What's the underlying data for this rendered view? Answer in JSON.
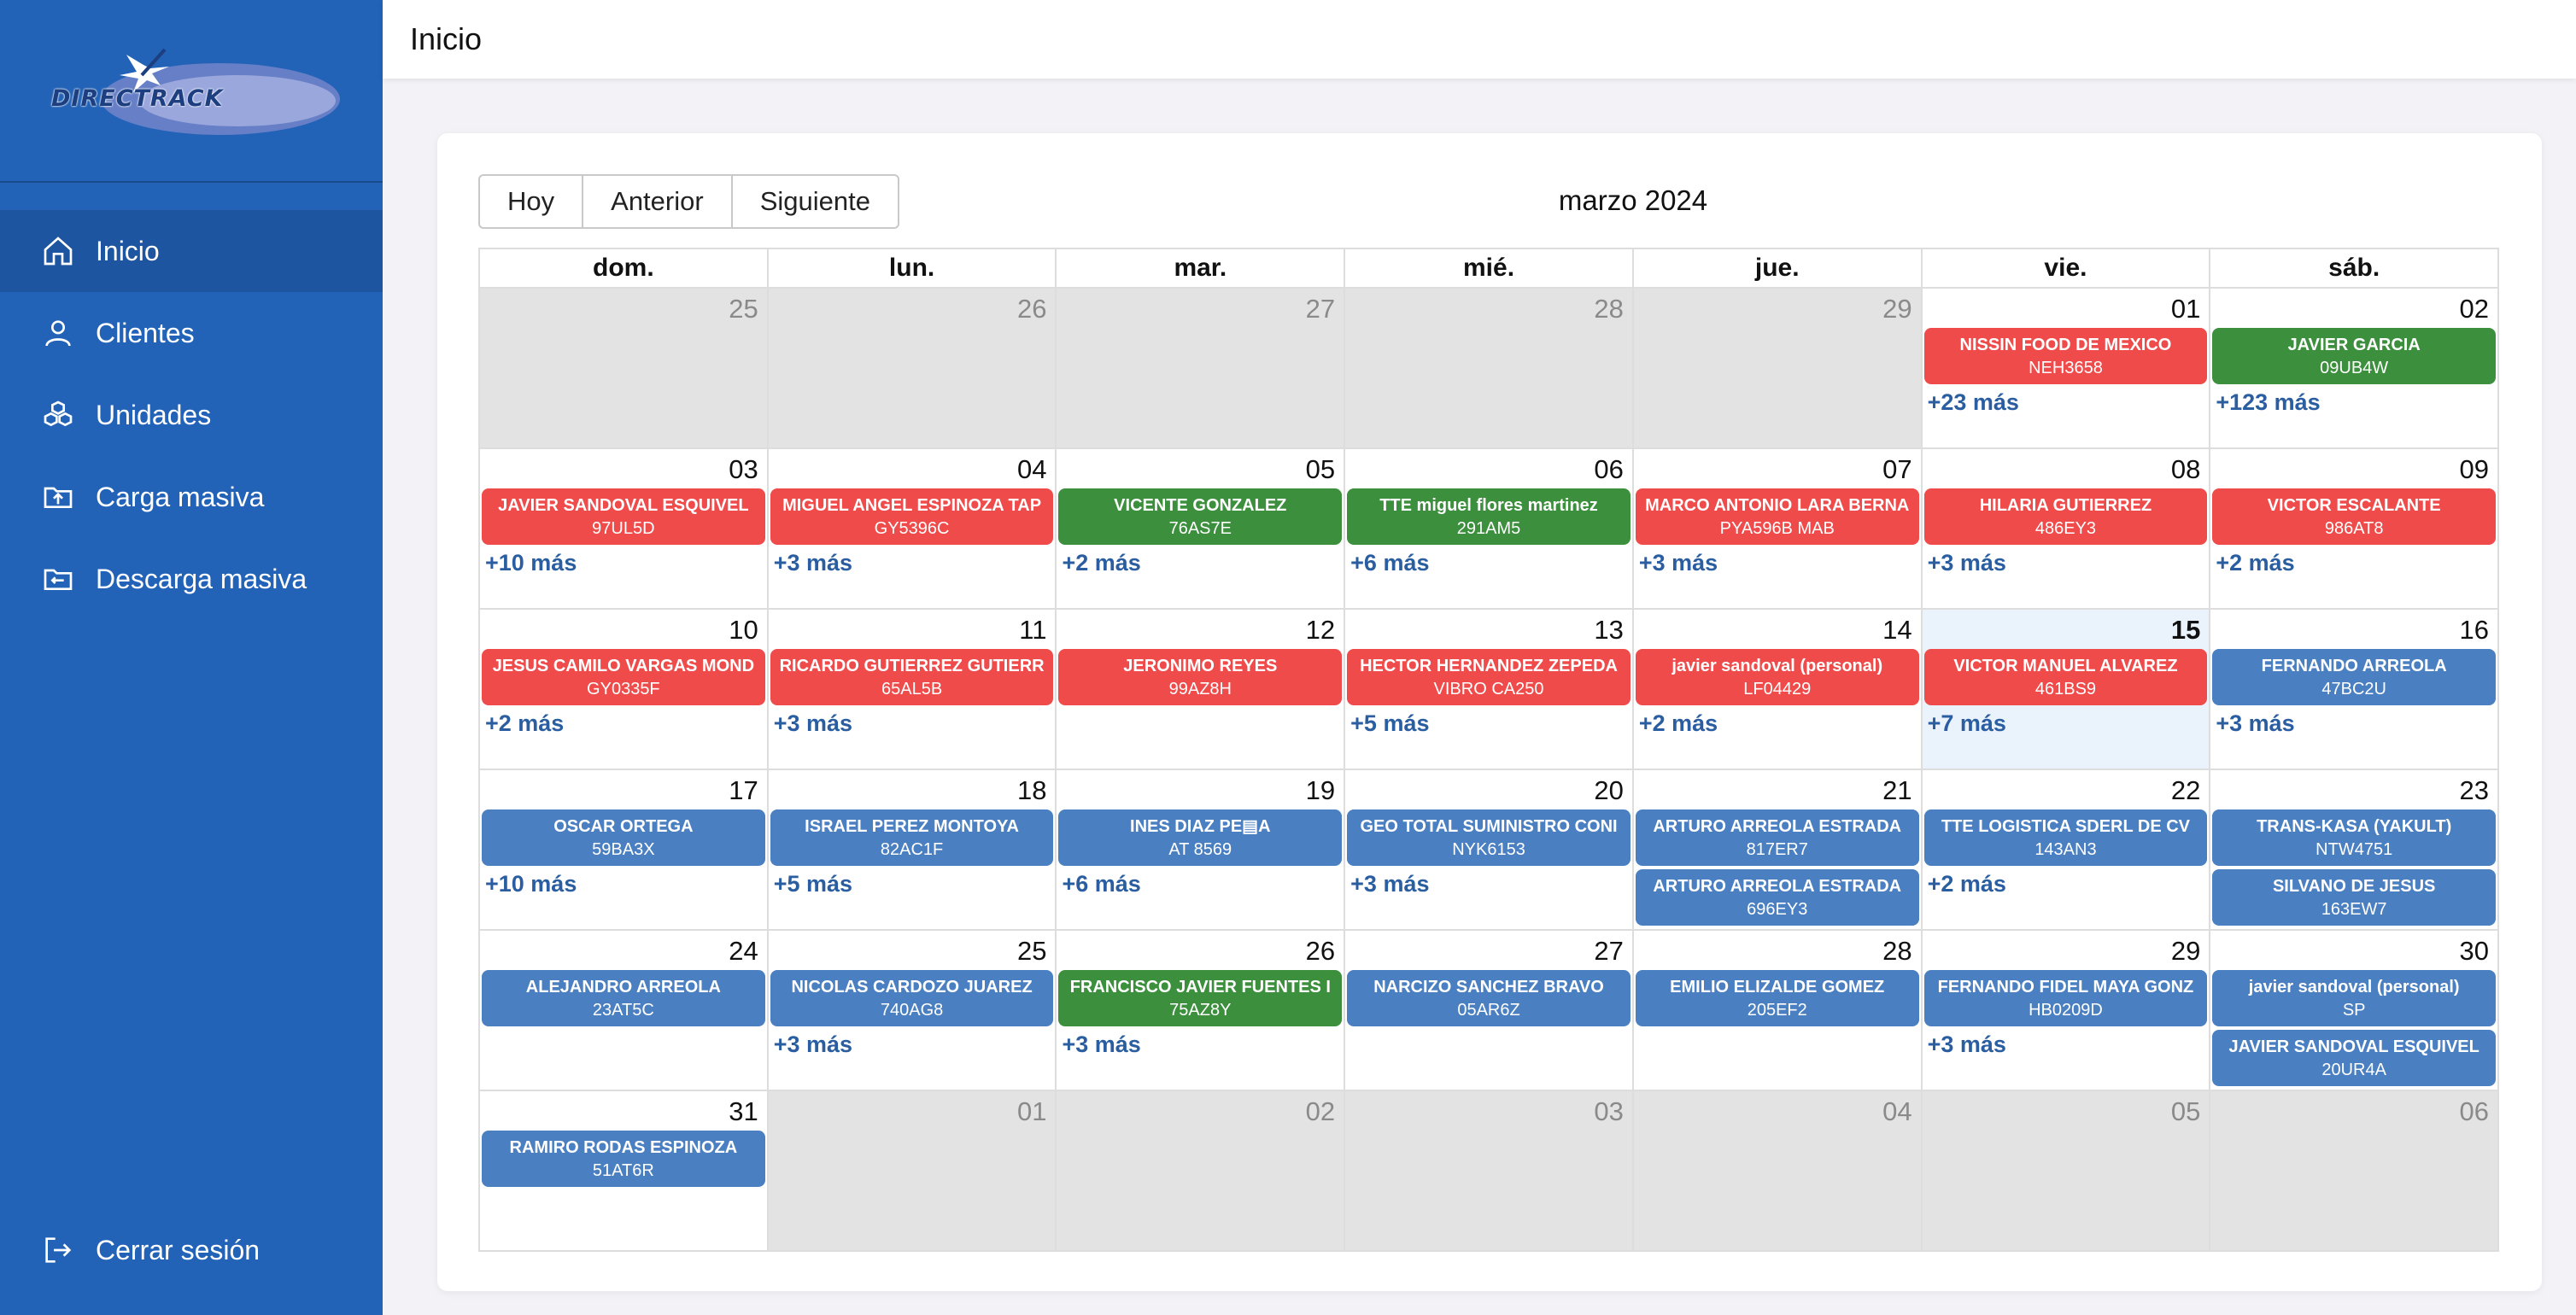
{
  "brand": {
    "logo_text": "DIRECTRACK"
  },
  "header": {
    "title": "Inicio"
  },
  "sidebar": {
    "items": [
      {
        "label": "Inicio",
        "icon": "home-icon",
        "active": true
      },
      {
        "label": "Clientes",
        "icon": "user-icon",
        "active": false
      },
      {
        "label": "Unidades",
        "icon": "units-icon",
        "active": false
      },
      {
        "label": "Carga masiva",
        "icon": "upload-folder-icon",
        "active": false
      },
      {
        "label": "Descarga masiva",
        "icon": "download-folder-icon",
        "active": false
      }
    ],
    "logout_label": "Cerrar sesión"
  },
  "toolbar": {
    "today": "Hoy",
    "prev": "Anterior",
    "next": "Siguiente"
  },
  "calendar": {
    "title": "marzo 2024",
    "weekdays": [
      "dom.",
      "lun.",
      "mar.",
      "mié.",
      "jue.",
      "vie.",
      "sáb."
    ],
    "colors": {
      "red": "#f04b4b",
      "green": "#3c8f3c",
      "blue": "#4a7fc1",
      "today_bg": "#eaf2fc"
    },
    "weeks": [
      [
        {
          "day": "25",
          "other": true,
          "events": []
        },
        {
          "day": "26",
          "other": true,
          "events": []
        },
        {
          "day": "27",
          "other": true,
          "events": []
        },
        {
          "day": "28",
          "other": true,
          "events": []
        },
        {
          "day": "29",
          "other": true,
          "events": []
        },
        {
          "day": "01",
          "events": [
            {
              "name": "NISSIN FOOD DE MEXICO",
              "plate": "NEH3658",
              "color": "red"
            }
          ],
          "more": "+23 más"
        },
        {
          "day": "02",
          "events": [
            {
              "name": "JAVIER GARCIA",
              "plate": "09UB4W",
              "color": "green"
            }
          ],
          "more": "+123 más"
        }
      ],
      [
        {
          "day": "03",
          "events": [
            {
              "name": "JAVIER SANDOVAL ESQUIVEL",
              "plate": "97UL5D",
              "color": "red"
            }
          ],
          "more": "+10 más"
        },
        {
          "day": "04",
          "events": [
            {
              "name": "MIGUEL ANGEL ESPINOZA TAP",
              "plate": "GY5396C",
              "color": "red"
            }
          ],
          "more": "+3 más"
        },
        {
          "day": "05",
          "events": [
            {
              "name": "VICENTE GONZALEZ",
              "plate": "76AS7E",
              "color": "green"
            }
          ],
          "more": "+2 más"
        },
        {
          "day": "06",
          "events": [
            {
              "name": "TTE miguel flores martinez",
              "plate": "291AM5",
              "color": "green"
            }
          ],
          "more": "+6 más"
        },
        {
          "day": "07",
          "events": [
            {
              "name": "MARCO ANTONIO LARA BERNA",
              "plate": "PYA596B MAB",
              "color": "red"
            }
          ],
          "more": "+3 más"
        },
        {
          "day": "08",
          "events": [
            {
              "name": "HILARIA GUTIERREZ",
              "plate": "486EY3",
              "color": "red"
            }
          ],
          "more": "+3 más"
        },
        {
          "day": "09",
          "events": [
            {
              "name": "VICTOR ESCALANTE",
              "plate": "986AT8",
              "color": "red"
            }
          ],
          "more": "+2 más"
        }
      ],
      [
        {
          "day": "10",
          "events": [
            {
              "name": "JESUS CAMILO VARGAS MOND",
              "plate": "GY0335F",
              "color": "red"
            }
          ],
          "more": "+2 más"
        },
        {
          "day": "11",
          "events": [
            {
              "name": "RICARDO GUTIERREZ GUTIERR",
              "plate": "65AL5B",
              "color": "red"
            }
          ],
          "more": "+3 más"
        },
        {
          "day": "12",
          "events": [
            {
              "name": "JERONIMO REYES",
              "plate": "99AZ8H",
              "color": "red"
            }
          ]
        },
        {
          "day": "13",
          "events": [
            {
              "name": "HECTOR HERNANDEZ ZEPEDA",
              "plate": "VIBRO CA250",
              "color": "red"
            }
          ],
          "more": "+5 más"
        },
        {
          "day": "14",
          "events": [
            {
              "name": "javier sandoval (personal)",
              "plate": "LF04429",
              "color": "red"
            }
          ],
          "more": "+2 más"
        },
        {
          "day": "15",
          "today": true,
          "events": [
            {
              "name": "VICTOR MANUEL ALVAREZ",
              "plate": "461BS9",
              "color": "red"
            }
          ],
          "more": "+7 más"
        },
        {
          "day": "16",
          "events": [
            {
              "name": "FERNANDO ARREOLA",
              "plate": "47BC2U",
              "color": "blue"
            }
          ],
          "more": "+3 más"
        }
      ],
      [
        {
          "day": "17",
          "events": [
            {
              "name": "OSCAR ORTEGA",
              "plate": "59BA3X",
              "color": "blue"
            }
          ],
          "more": "+10 más"
        },
        {
          "day": "18",
          "events": [
            {
              "name": "ISRAEL PEREZ MONTOYA",
              "plate": "82AC1F",
              "color": "blue"
            }
          ],
          "more": "+5 más"
        },
        {
          "day": "19",
          "events": [
            {
              "name": "INES DIAZ PE▤A",
              "plate": "AT 8569",
              "color": "blue"
            }
          ],
          "more": "+6 más"
        },
        {
          "day": "20",
          "events": [
            {
              "name": "GEO TOTAL SUMINISTRO CONI",
              "plate": "NYK6153",
              "color": "blue"
            }
          ],
          "more": "+3 más"
        },
        {
          "day": "21",
          "events": [
            {
              "name": "ARTURO ARREOLA ESTRADA",
              "plate": "817ER7",
              "color": "blue"
            },
            {
              "name": "ARTURO ARREOLA ESTRADA",
              "plate": "696EY3",
              "color": "blue"
            }
          ]
        },
        {
          "day": "22",
          "events": [
            {
              "name": "TTE LOGISTICA SDERL DE CV",
              "plate": "143AN3",
              "color": "blue"
            }
          ],
          "more": "+2 más"
        },
        {
          "day": "23",
          "events": [
            {
              "name": "TRANS-KASA (YAKULT)",
              "plate": "NTW4751",
              "color": "blue"
            },
            {
              "name": "SILVANO DE JESUS",
              "plate": "163EW7",
              "color": "blue"
            }
          ]
        }
      ],
      [
        {
          "day": "24",
          "events": [
            {
              "name": "ALEJANDRO ARREOLA",
              "plate": "23AT5C",
              "color": "blue"
            }
          ]
        },
        {
          "day": "25",
          "events": [
            {
              "name": "NICOLAS CARDOZO JUAREZ",
              "plate": "740AG8",
              "color": "blue"
            }
          ],
          "more": "+3 más"
        },
        {
          "day": "26",
          "events": [
            {
              "name": "FRANCISCO JAVIER FUENTES I",
              "plate": "75AZ8Y",
              "color": "green"
            }
          ],
          "more": "+3 más"
        },
        {
          "day": "27",
          "events": [
            {
              "name": "NARCIZO SANCHEZ BRAVO",
              "plate": "05AR6Z",
              "color": "blue"
            }
          ]
        },
        {
          "day": "28",
          "events": [
            {
              "name": "EMILIO ELIZALDE GOMEZ",
              "plate": "205EF2",
              "color": "blue"
            }
          ]
        },
        {
          "day": "29",
          "events": [
            {
              "name": "FERNANDO FIDEL MAYA GONZ",
              "plate": "HB0209D",
              "color": "blue"
            }
          ],
          "more": "+3 más"
        },
        {
          "day": "30",
          "events": [
            {
              "name": "javier sandoval (personal)",
              "plate": "SP",
              "color": "blue"
            },
            {
              "name": "JAVIER SANDOVAL ESQUIVEL",
              "plate": "20UR4A",
              "color": "blue"
            }
          ]
        }
      ],
      [
        {
          "day": "31",
          "events": [
            {
              "name": "RAMIRO RODAS ESPINOZA",
              "plate": "51AT6R",
              "color": "blue"
            }
          ]
        },
        {
          "day": "01",
          "other": true,
          "events": []
        },
        {
          "day": "02",
          "other": true,
          "events": []
        },
        {
          "day": "03",
          "other": true,
          "events": []
        },
        {
          "day": "04",
          "other": true,
          "events": []
        },
        {
          "day": "05",
          "other": true,
          "events": []
        },
        {
          "day": "06",
          "other": true,
          "events": []
        }
      ]
    ]
  }
}
